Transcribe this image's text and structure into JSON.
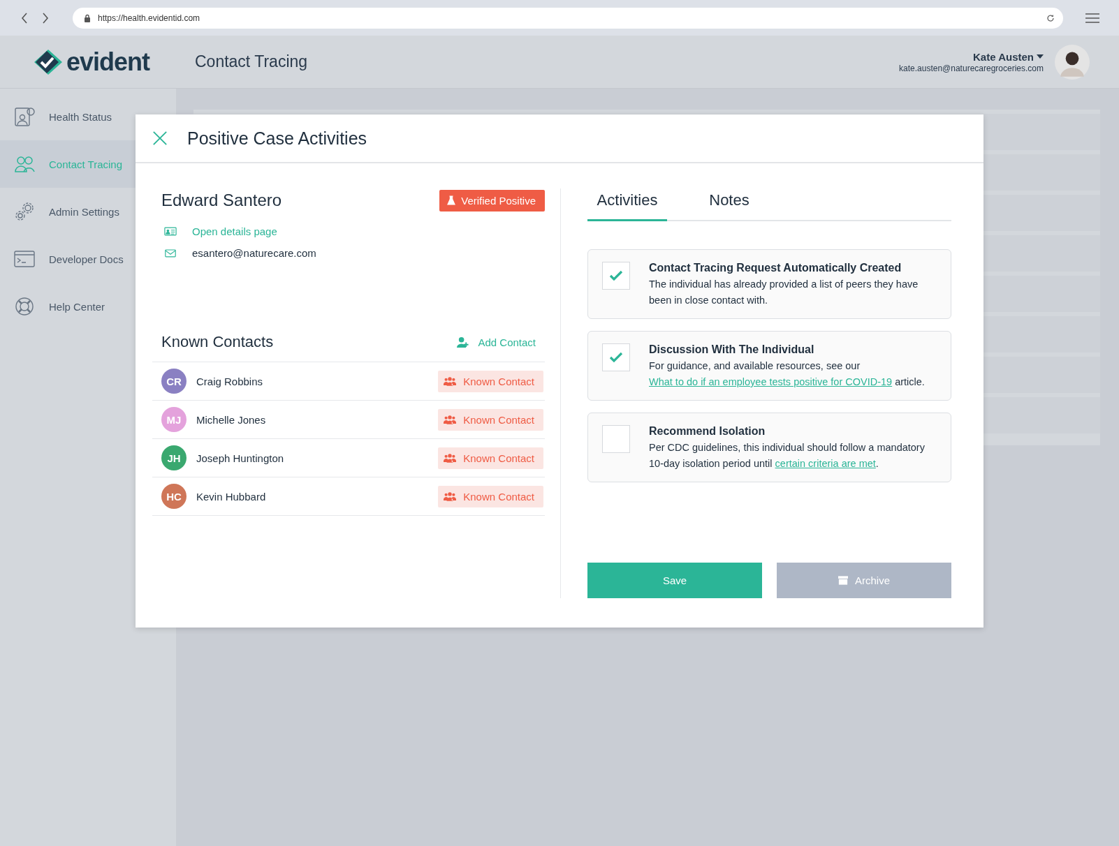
{
  "browser": {
    "url": "https://health.evidentid.com"
  },
  "header": {
    "logo": "evident",
    "page_title": "Contact Tracing",
    "user": {
      "name": "Kate Austen",
      "email": "kate.austen@naturecaregroceries.com"
    }
  },
  "sidebar": {
    "items": [
      {
        "label": "Health Status",
        "kind": "health",
        "selected": false
      },
      {
        "label": "Contact Tracing",
        "kind": "contacts",
        "selected": true
      },
      {
        "label": "Admin Settings",
        "kind": "settings",
        "selected": false
      },
      {
        "label": "Developer Docs",
        "kind": "docs",
        "selected": false
      },
      {
        "label": "Help Center",
        "kind": "help",
        "selected": false
      }
    ]
  },
  "modal": {
    "title": "Positive Case Activities",
    "person": {
      "name": "Edward Santero",
      "badge": "Verified Positive",
      "details_link": "Open details page",
      "email": "esantero@naturecare.com"
    },
    "known_contacts": {
      "heading": "Known Contacts",
      "add_button": "Add Contact",
      "rows": [
        {
          "initials": "CR",
          "name": "Craig Robbins",
          "color": "#8a80c2",
          "tag": "Known Contact"
        },
        {
          "initials": "MJ",
          "name": "Michelle Jones",
          "color": "#e4a2dc",
          "tag": "Known Contact"
        },
        {
          "initials": "JH",
          "name": "Joseph Huntington",
          "color": "#3aa86f",
          "tag": "Known Contact"
        },
        {
          "initials": "HC",
          "name": "Kevin Hubbard",
          "color": "#cf7658",
          "tag": "Known Contact"
        }
      ]
    },
    "tabs": [
      {
        "label": "Activities",
        "selected": true
      },
      {
        "label": "Notes",
        "selected": false
      }
    ],
    "activities": [
      {
        "title": "Contact Tracing Request Automatically Created",
        "checked": true,
        "segments": [
          {
            "kind": "text",
            "text": "The individual has already provided a list of peers they have been in close contact with."
          }
        ]
      },
      {
        "title": "Discussion With The Individual",
        "checked": true,
        "segments": [
          {
            "kind": "text",
            "text": "For guidance, and available resources, see our "
          },
          {
            "kind": "link",
            "text": "What to do if an employee tests positive for COVID-19"
          },
          {
            "kind": "text",
            "text": " article."
          }
        ]
      },
      {
        "title": "Recommend Isolation",
        "checked": false,
        "segments": [
          {
            "kind": "text",
            "text": "Per CDC guidelines, this individual should follow a mandatory 10-day isolation period until "
          },
          {
            "kind": "link",
            "text": "certain criteria are met"
          },
          {
            "kind": "text",
            "text": "."
          }
        ]
      }
    ],
    "buttons": [
      {
        "label": "Save",
        "kind": "primary",
        "disabled": false
      },
      {
        "label": "Archive",
        "kind": "archive",
        "disabled": true
      }
    ]
  }
}
